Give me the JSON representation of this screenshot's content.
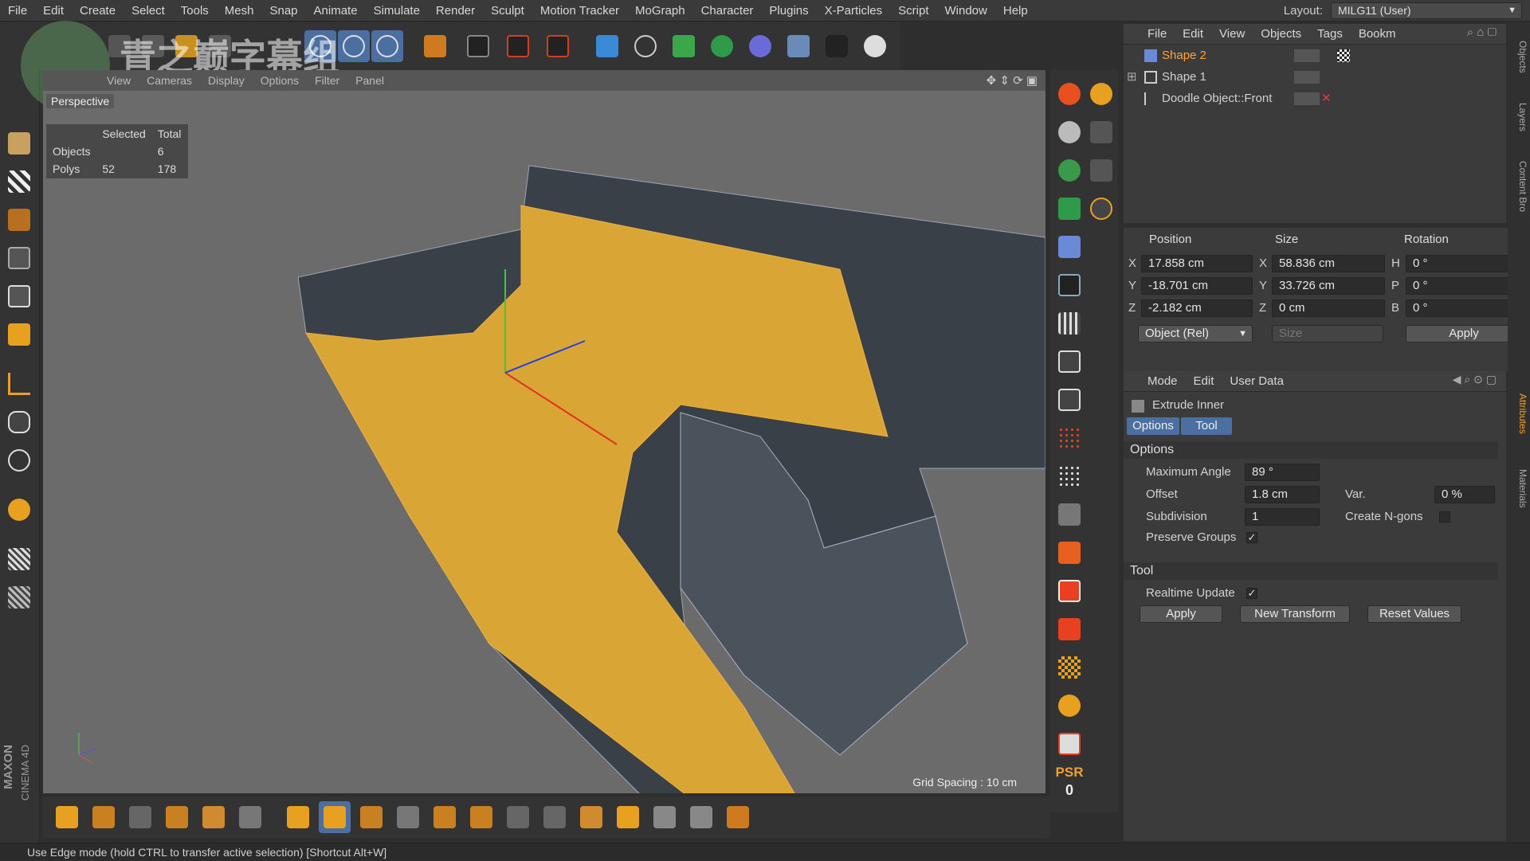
{
  "menubar": {
    "items": [
      "File",
      "Edit",
      "Create",
      "Select",
      "Tools",
      "Mesh",
      "Snap",
      "Animate",
      "Simulate",
      "Render",
      "Sculpt",
      "Motion Tracker",
      "MoGraph",
      "Character",
      "Plugins",
      "X-Particles",
      "Script",
      "Window",
      "Help"
    ],
    "layout_label": "Layout:",
    "layout_value": "MILG11 (User)"
  },
  "watermark": {
    "text": "青之巅字幕组"
  },
  "viewport": {
    "menu": [
      "View",
      "Cameras",
      "Display",
      "Options",
      "Filter",
      "Panel"
    ],
    "name": "Perspective",
    "hud": {
      "col1": "Selected",
      "col2": "Total",
      "rows": [
        {
          "label": "Objects",
          "selected": "",
          "total": "6"
        },
        {
          "label": "Polys",
          "selected": "52",
          "total": "178"
        }
      ]
    },
    "grid_spacing": "Grid Spacing : 10 cm"
  },
  "object_manager": {
    "menu": [
      "File",
      "Edit",
      "View",
      "Objects",
      "Tags",
      "Bookm"
    ],
    "objects": [
      {
        "name": "Shape 2",
        "selected": true
      },
      {
        "name": "Shape 1",
        "selected": false
      },
      {
        "name": "Doodle Object::Front",
        "selected": false
      }
    ]
  },
  "coordinates": {
    "headers": {
      "position": "Position",
      "size": "Size",
      "rotation": "Rotation"
    },
    "rows": [
      {
        "axis": "X",
        "pos": "17.858 cm",
        "saxis": "X",
        "size": "58.836 cm",
        "raxis": "H",
        "rot": "0 °"
      },
      {
        "axis": "Y",
        "pos": "-18.701 cm",
        "saxis": "Y",
        "size": "33.726 cm",
        "raxis": "P",
        "rot": "0 °"
      },
      {
        "axis": "Z",
        "pos": "-2.182 cm",
        "saxis": "Z",
        "size": "0 cm",
        "raxis": "B",
        "rot": "0 °"
      }
    ],
    "mode": "Object (Rel)",
    "size_mode": "Size",
    "apply": "Apply"
  },
  "attributes": {
    "menu": [
      "Mode",
      "Edit",
      "User Data"
    ],
    "tool_name": "Extrude Inner",
    "tabs": [
      "Options",
      "Tool"
    ],
    "options_title": "Options",
    "max_angle_label": "Maximum Angle",
    "max_angle": "89 °",
    "offset_label": "Offset",
    "offset": "1.8 cm",
    "var_label": "Var.",
    "var": "0 %",
    "subdivision_label": "Subdivision",
    "subdivision": "1",
    "ngons_label": "Create N-gons",
    "preserve_label": "Preserve Groups",
    "tool_title": "Tool",
    "realtime_label": "Realtime Update",
    "apply": "Apply",
    "new_transform": "New Transform",
    "reset_values": "Reset Values"
  },
  "right_tabs": [
    "Objects",
    "Layers",
    "Content Bro",
    "Attributes",
    "Materials"
  ],
  "psr": {
    "label": "PSR",
    "value": "0"
  },
  "brand": {
    "maxon": "MAXON",
    "cinema": "CINEMA 4D"
  },
  "statusbar": {
    "text": "Use Edge mode (hold CTRL to transfer active selection) [Shortcut Alt+W]"
  },
  "colors": {
    "accent": "#f0a030",
    "selection": "#ffa53a",
    "mesh_dark": "#3a4048",
    "mesh_face": "#d9a534"
  }
}
